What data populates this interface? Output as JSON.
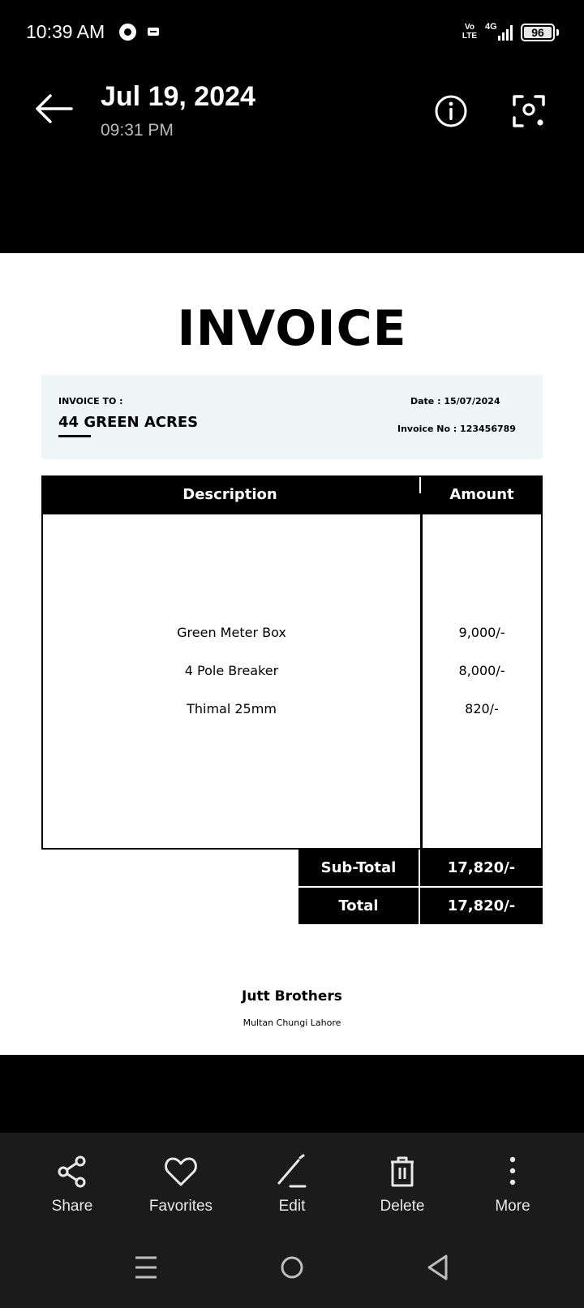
{
  "status_bar": {
    "time": "10:39 AM",
    "volte": "Vo LTE",
    "network": "4G",
    "battery": "96",
    "icons": [
      "circle-notification-icon",
      "voicemail-icon",
      "signal-icon",
      "battery-icon"
    ]
  },
  "header": {
    "date": "Jul 19, 2024",
    "time": "09:31 PM",
    "icons": [
      "back-arrow-icon",
      "info-icon",
      "lens-scan-icon"
    ]
  },
  "invoice": {
    "title": "INVOICE",
    "bill_to_label": "INVOICE TO :",
    "bill_to_name": "44 GREEN ACRES",
    "date": "Date : 15/07/2024",
    "invoice_no": "Invoice No : 123456789",
    "columns": [
      "Description",
      "Amount"
    ],
    "items": [
      {
        "description": "Green Meter Box",
        "amount": "9,000/-"
      },
      {
        "description": "4 Pole Breaker",
        "amount": "8,000/-"
      },
      {
        "description": "Thimal 25mm",
        "amount": "820/-"
      }
    ],
    "subtotal_label": "Sub-Total",
    "subtotal_value": "17,820/-",
    "total_label": "Total",
    "total_value": "17,820/-",
    "company": "Jutt Brothers",
    "address": "Multan Chungi Lahore"
  },
  "actions": [
    {
      "label": "Share",
      "icon": "share-icon"
    },
    {
      "label": "Favorites",
      "icon": "heart-icon"
    },
    {
      "label": "Edit",
      "icon": "pencil-icon"
    },
    {
      "label": "Delete",
      "icon": "trash-icon"
    },
    {
      "label": "More",
      "icon": "more-vertical-icon"
    }
  ],
  "nav": [
    "recents-icon",
    "home-icon",
    "back-icon"
  ]
}
